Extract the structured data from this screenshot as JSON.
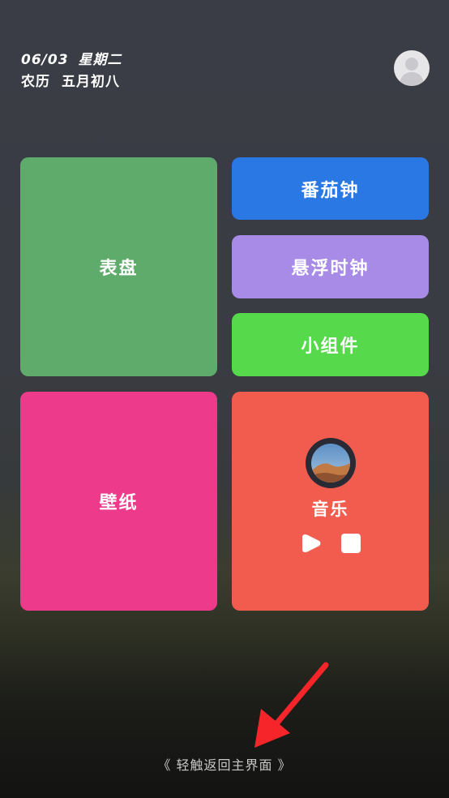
{
  "header": {
    "date": "06/03",
    "weekday": "星期二",
    "lunar_label": "农历",
    "lunar_date": "五月初八"
  },
  "avatar": {
    "icon": "user-avatar-icon"
  },
  "tiles": {
    "clock_face": "表盘",
    "pomodoro": "番茄钟",
    "floating_clock": "悬浮时钟",
    "widget": "小组件",
    "wallpaper": "壁纸",
    "music": "音乐"
  },
  "music": {
    "play_icon": "play-icon",
    "stop_icon": "stop-icon"
  },
  "footer": {
    "hint": "《 轻触返回主界面 》"
  },
  "colors": {
    "clock_face": "#5fab6c",
    "pomodoro": "#2a78e3",
    "floating_clock": "#a78be6",
    "widget": "#56d94a",
    "wallpaper": "#ee3a8a",
    "music": "#f15c4f",
    "arrow": "#f5252a"
  }
}
